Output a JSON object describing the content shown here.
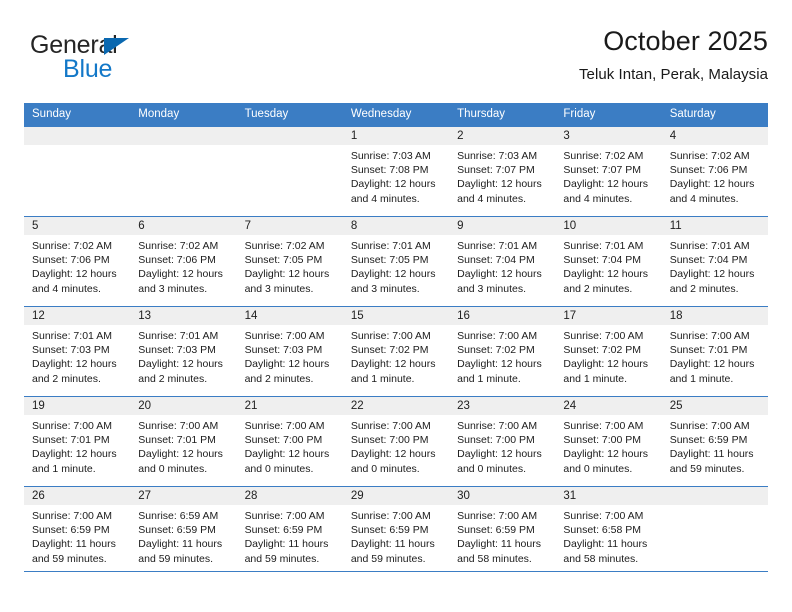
{
  "brand": {
    "name_top": "General",
    "name_bottom": "Blue"
  },
  "header": {
    "title": "October 2025",
    "subtitle": "Teluk Intan, Perak, Malaysia"
  },
  "colors": {
    "header_blue": "#3b7dc4",
    "brand_blue": "#1378c8",
    "logo_triangle": "#0a68b0",
    "daynum_band": "#efefef"
  },
  "weekday_headers": [
    "Sunday",
    "Monday",
    "Tuesday",
    "Wednesday",
    "Thursday",
    "Friday",
    "Saturday"
  ],
  "weeks": [
    [
      {
        "day": "",
        "sunrise": "",
        "sunset": "",
        "daylight1": "",
        "daylight2": ""
      },
      {
        "day": "",
        "sunrise": "",
        "sunset": "",
        "daylight1": "",
        "daylight2": ""
      },
      {
        "day": "",
        "sunrise": "",
        "sunset": "",
        "daylight1": "",
        "daylight2": ""
      },
      {
        "day": "1",
        "sunrise": "Sunrise: 7:03 AM",
        "sunset": "Sunset: 7:08 PM",
        "daylight1": "Daylight: 12 hours",
        "daylight2": "and 4 minutes."
      },
      {
        "day": "2",
        "sunrise": "Sunrise: 7:03 AM",
        "sunset": "Sunset: 7:07 PM",
        "daylight1": "Daylight: 12 hours",
        "daylight2": "and 4 minutes."
      },
      {
        "day": "3",
        "sunrise": "Sunrise: 7:02 AM",
        "sunset": "Sunset: 7:07 PM",
        "daylight1": "Daylight: 12 hours",
        "daylight2": "and 4 minutes."
      },
      {
        "day": "4",
        "sunrise": "Sunrise: 7:02 AM",
        "sunset": "Sunset: 7:06 PM",
        "daylight1": "Daylight: 12 hours",
        "daylight2": "and 4 minutes."
      }
    ],
    [
      {
        "day": "5",
        "sunrise": "Sunrise: 7:02 AM",
        "sunset": "Sunset: 7:06 PM",
        "daylight1": "Daylight: 12 hours",
        "daylight2": "and 4 minutes."
      },
      {
        "day": "6",
        "sunrise": "Sunrise: 7:02 AM",
        "sunset": "Sunset: 7:06 PM",
        "daylight1": "Daylight: 12 hours",
        "daylight2": "and 3 minutes."
      },
      {
        "day": "7",
        "sunrise": "Sunrise: 7:02 AM",
        "sunset": "Sunset: 7:05 PM",
        "daylight1": "Daylight: 12 hours",
        "daylight2": "and 3 minutes."
      },
      {
        "day": "8",
        "sunrise": "Sunrise: 7:01 AM",
        "sunset": "Sunset: 7:05 PM",
        "daylight1": "Daylight: 12 hours",
        "daylight2": "and 3 minutes."
      },
      {
        "day": "9",
        "sunrise": "Sunrise: 7:01 AM",
        "sunset": "Sunset: 7:04 PM",
        "daylight1": "Daylight: 12 hours",
        "daylight2": "and 3 minutes."
      },
      {
        "day": "10",
        "sunrise": "Sunrise: 7:01 AM",
        "sunset": "Sunset: 7:04 PM",
        "daylight1": "Daylight: 12 hours",
        "daylight2": "and 2 minutes."
      },
      {
        "day": "11",
        "sunrise": "Sunrise: 7:01 AM",
        "sunset": "Sunset: 7:04 PM",
        "daylight1": "Daylight: 12 hours",
        "daylight2": "and 2 minutes."
      }
    ],
    [
      {
        "day": "12",
        "sunrise": "Sunrise: 7:01 AM",
        "sunset": "Sunset: 7:03 PM",
        "daylight1": "Daylight: 12 hours",
        "daylight2": "and 2 minutes."
      },
      {
        "day": "13",
        "sunrise": "Sunrise: 7:01 AM",
        "sunset": "Sunset: 7:03 PM",
        "daylight1": "Daylight: 12 hours",
        "daylight2": "and 2 minutes."
      },
      {
        "day": "14",
        "sunrise": "Sunrise: 7:00 AM",
        "sunset": "Sunset: 7:03 PM",
        "daylight1": "Daylight: 12 hours",
        "daylight2": "and 2 minutes."
      },
      {
        "day": "15",
        "sunrise": "Sunrise: 7:00 AM",
        "sunset": "Sunset: 7:02 PM",
        "daylight1": "Daylight: 12 hours",
        "daylight2": "and 1 minute."
      },
      {
        "day": "16",
        "sunrise": "Sunrise: 7:00 AM",
        "sunset": "Sunset: 7:02 PM",
        "daylight1": "Daylight: 12 hours",
        "daylight2": "and 1 minute."
      },
      {
        "day": "17",
        "sunrise": "Sunrise: 7:00 AM",
        "sunset": "Sunset: 7:02 PM",
        "daylight1": "Daylight: 12 hours",
        "daylight2": "and 1 minute."
      },
      {
        "day": "18",
        "sunrise": "Sunrise: 7:00 AM",
        "sunset": "Sunset: 7:01 PM",
        "daylight1": "Daylight: 12 hours",
        "daylight2": "and 1 minute."
      }
    ],
    [
      {
        "day": "19",
        "sunrise": "Sunrise: 7:00 AM",
        "sunset": "Sunset: 7:01 PM",
        "daylight1": "Daylight: 12 hours",
        "daylight2": "and 1 minute."
      },
      {
        "day": "20",
        "sunrise": "Sunrise: 7:00 AM",
        "sunset": "Sunset: 7:01 PM",
        "daylight1": "Daylight: 12 hours",
        "daylight2": "and 0 minutes."
      },
      {
        "day": "21",
        "sunrise": "Sunrise: 7:00 AM",
        "sunset": "Sunset: 7:00 PM",
        "daylight1": "Daylight: 12 hours",
        "daylight2": "and 0 minutes."
      },
      {
        "day": "22",
        "sunrise": "Sunrise: 7:00 AM",
        "sunset": "Sunset: 7:00 PM",
        "daylight1": "Daylight: 12 hours",
        "daylight2": "and 0 minutes."
      },
      {
        "day": "23",
        "sunrise": "Sunrise: 7:00 AM",
        "sunset": "Sunset: 7:00 PM",
        "daylight1": "Daylight: 12 hours",
        "daylight2": "and 0 minutes."
      },
      {
        "day": "24",
        "sunrise": "Sunrise: 7:00 AM",
        "sunset": "Sunset: 7:00 PM",
        "daylight1": "Daylight: 12 hours",
        "daylight2": "and 0 minutes."
      },
      {
        "day": "25",
        "sunrise": "Sunrise: 7:00 AM",
        "sunset": "Sunset: 6:59 PM",
        "daylight1": "Daylight: 11 hours",
        "daylight2": "and 59 minutes."
      }
    ],
    [
      {
        "day": "26",
        "sunrise": "Sunrise: 7:00 AM",
        "sunset": "Sunset: 6:59 PM",
        "daylight1": "Daylight: 11 hours",
        "daylight2": "and 59 minutes."
      },
      {
        "day": "27",
        "sunrise": "Sunrise: 6:59 AM",
        "sunset": "Sunset: 6:59 PM",
        "daylight1": "Daylight: 11 hours",
        "daylight2": "and 59 minutes."
      },
      {
        "day": "28",
        "sunrise": "Sunrise: 7:00 AM",
        "sunset": "Sunset: 6:59 PM",
        "daylight1": "Daylight: 11 hours",
        "daylight2": "and 59 minutes."
      },
      {
        "day": "29",
        "sunrise": "Sunrise: 7:00 AM",
        "sunset": "Sunset: 6:59 PM",
        "daylight1": "Daylight: 11 hours",
        "daylight2": "and 59 minutes."
      },
      {
        "day": "30",
        "sunrise": "Sunrise: 7:00 AM",
        "sunset": "Sunset: 6:59 PM",
        "daylight1": "Daylight: 11 hours",
        "daylight2": "and 58 minutes."
      },
      {
        "day": "31",
        "sunrise": "Sunrise: 7:00 AM",
        "sunset": "Sunset: 6:58 PM",
        "daylight1": "Daylight: 11 hours",
        "daylight2": "and 58 minutes."
      },
      {
        "day": "",
        "sunrise": "",
        "sunset": "",
        "daylight1": "",
        "daylight2": ""
      }
    ]
  ]
}
